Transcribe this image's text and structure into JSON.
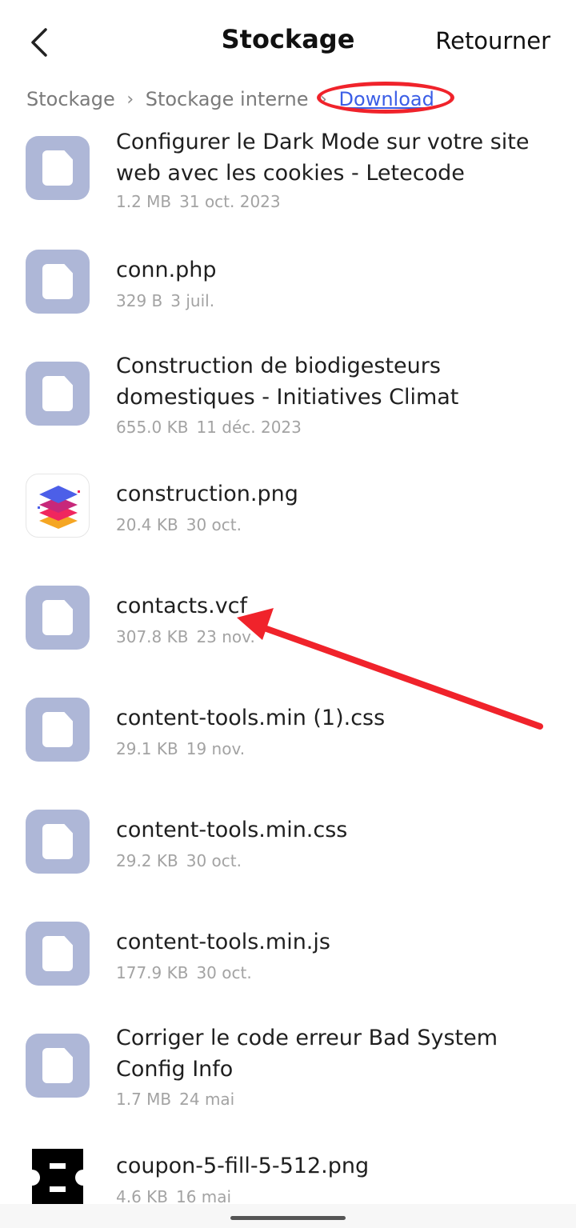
{
  "header": {
    "title": "Stockage",
    "action": "Retourner"
  },
  "breadcrumb": [
    "Stockage",
    "Stockage interne",
    "Download"
  ],
  "files": [
    {
      "name": "Configurer le Dark Mode sur votre site web avec les cookies - Letecode",
      "size": "1.2 MB",
      "date": "31 oct. 2023",
      "icon": "file-icon"
    },
    {
      "name": "conn.php",
      "size": "329 B",
      "date": "3 juil.",
      "icon": "file-icon"
    },
    {
      "name": "Construction de biodigesteurs domestiques - Initiatives Climat",
      "size": "655.0 KB",
      "date": "11 déc. 2023",
      "icon": "file-icon"
    },
    {
      "name": "construction.png",
      "size": "20.4 KB",
      "date": "30 oct.",
      "icon": "layers-image-thumbnail"
    },
    {
      "name": "contacts.vcf",
      "size": "307.8 KB",
      "date": "23 nov.",
      "icon": "file-icon"
    },
    {
      "name": "content-tools.min (1).css",
      "size": "29.1 KB",
      "date": "19 nov.",
      "icon": "file-icon"
    },
    {
      "name": "content-tools.min.css",
      "size": "29.2 KB",
      "date": "30 oct.",
      "icon": "file-icon"
    },
    {
      "name": "content-tools.min.js",
      "size": "177.9 KB",
      "date": "30 oct.",
      "icon": "file-icon"
    },
    {
      "name": "Corriger le code erreur Bad System Config Info",
      "size": "1.7 MB",
      "date": "24 mai",
      "icon": "file-icon"
    },
    {
      "name": "coupon-5-fill-5-512.png",
      "size": "4.6 KB",
      "date": "16 mai",
      "icon": "coupon-image-thumbnail"
    }
  ],
  "colors": {
    "annotation": "#f0232b",
    "link": "#3b5ee6",
    "file_icon_bg": "#aeb7d7"
  }
}
